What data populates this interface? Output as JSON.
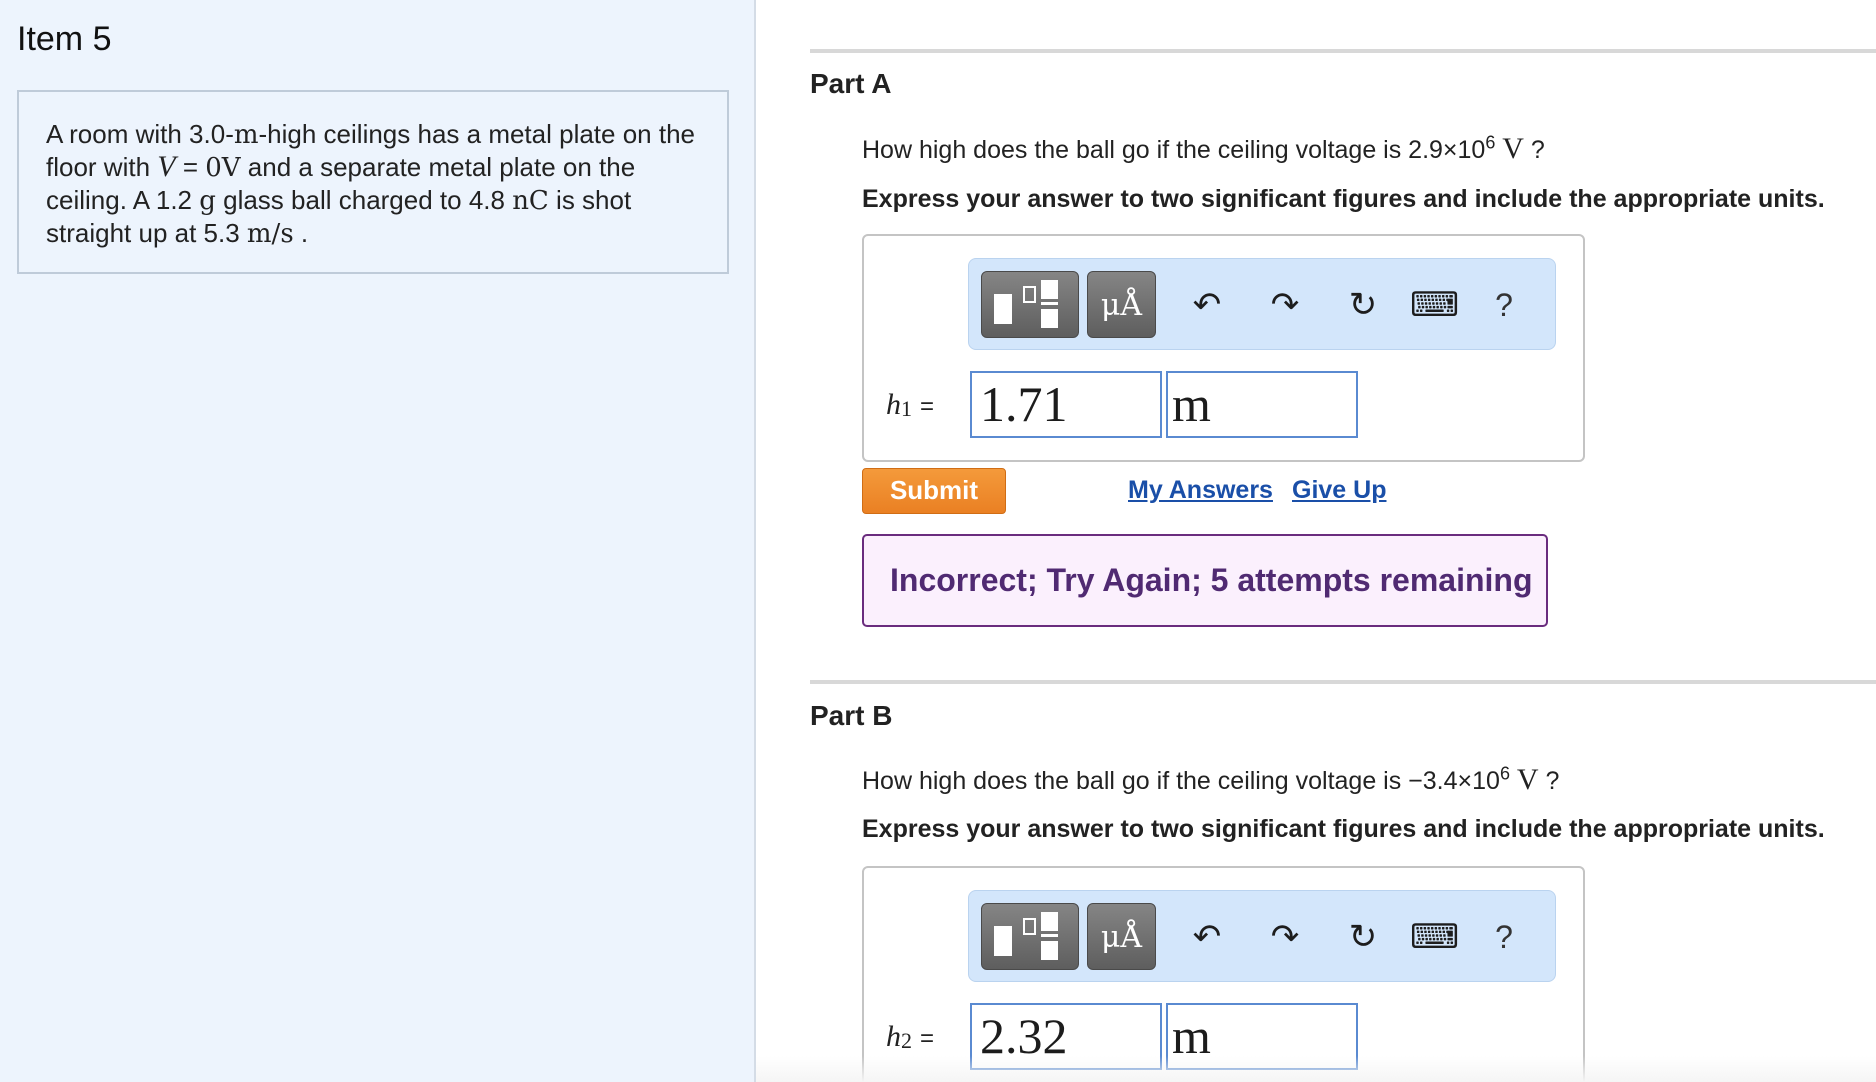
{
  "item": {
    "title": "Item 5"
  },
  "problem": {
    "t1": "A room with 3.0-",
    "m1": "m",
    "t2": "-high ceilings has a metal plate on the floor with ",
    "m2": "V",
    "t3": " = ",
    "m3": "0V",
    "t4": " and a separate metal plate on the ceiling. A 1.2 ",
    "m4": "g",
    "t5": " glass ball charged to 4.8 ",
    "m5": "nC",
    "t6": " is shot straight up at 5.3 ",
    "m6": "m/s",
    "t7": " ."
  },
  "toolbar": {
    "units_label": "μÅ",
    "icons": [
      "fraction-template-icon",
      "units-icon",
      "undo-icon",
      "redo-icon",
      "reset-icon",
      "keyboard-icon",
      "help-icon"
    ],
    "undo_glyph": "↶",
    "redo_glyph": "↷",
    "reset_glyph": "↻",
    "keyboard_glyph": "⌨",
    "help_glyph": "?"
  },
  "part_a": {
    "title": "Part A",
    "question_prefix": "How high does the ball go if the ceiling voltage is 2.9×10",
    "question_exp": "6",
    "question_unit": " V",
    "question_suffix": " ?",
    "instruction": "Express your answer to two significant figures and include the appropriate units.",
    "var_symbol": "h",
    "var_sub": "1",
    "eq": "=",
    "value": "1.71",
    "unit": "m",
    "submit_label": "Submit",
    "my_answers_label": "My Answers",
    "give_up_label": "Give Up",
    "feedback": "Incorrect; Try Again; 5 attempts remaining"
  },
  "part_b": {
    "title": "Part B",
    "question_prefix": "How high does the ball go if the ceiling voltage is −3.4×10",
    "question_exp": "6",
    "question_unit": " V",
    "question_suffix": " ?",
    "instruction": "Express your answer to two significant figures and include the appropriate units.",
    "var_symbol": "h",
    "var_sub": "2",
    "eq": "=",
    "value": "2.32",
    "unit": "m"
  },
  "colors": {
    "left_pane_bg": "#edf4fd",
    "toolbar_bg": "#d3e6fb",
    "submit_bg": "#ea8023",
    "link": "#1a4fa8",
    "feedback_border": "#6a2c7e",
    "feedback_text": "#502a72",
    "input_border": "#5a8ad1"
  }
}
